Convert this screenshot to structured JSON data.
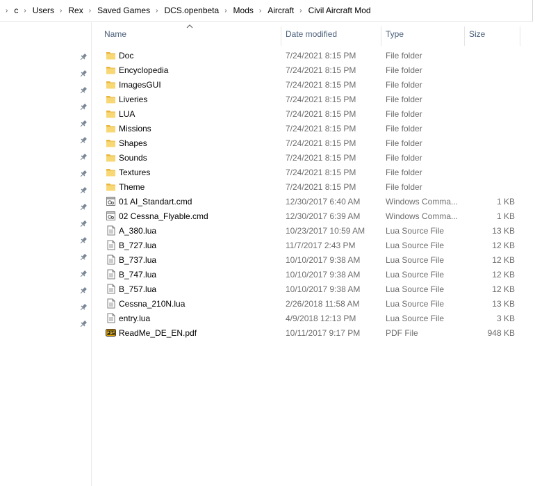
{
  "breadcrumb": [
    "c",
    "Users",
    "Rex",
    "Saved Games",
    "DCS.openbeta",
    "Mods",
    "Aircraft",
    "Civil Aircraft Mod"
  ],
  "columns": {
    "name": "Name",
    "date": "Date modified",
    "type": "Type",
    "size": "Size"
  },
  "sort": {
    "column": "Name",
    "direction": "ascending"
  },
  "pinned_count": 17,
  "files": [
    {
      "name": "Doc",
      "date": "7/24/2021 8:15 PM",
      "type": "File folder",
      "size": "",
      "icon": "folder-icon"
    },
    {
      "name": "Encyclopedia",
      "date": "7/24/2021 8:15 PM",
      "type": "File folder",
      "size": "",
      "icon": "folder-icon"
    },
    {
      "name": "ImagesGUI",
      "date": "7/24/2021 8:15 PM",
      "type": "File folder",
      "size": "",
      "icon": "folder-icon"
    },
    {
      "name": "Liveries",
      "date": "7/24/2021 8:15 PM",
      "type": "File folder",
      "size": "",
      "icon": "folder-icon"
    },
    {
      "name": "LUA",
      "date": "7/24/2021 8:15 PM",
      "type": "File folder",
      "size": "",
      "icon": "folder-icon"
    },
    {
      "name": "Missions",
      "date": "7/24/2021 8:15 PM",
      "type": "File folder",
      "size": "",
      "icon": "folder-icon"
    },
    {
      "name": "Shapes",
      "date": "7/24/2021 8:15 PM",
      "type": "File folder",
      "size": "",
      "icon": "folder-icon"
    },
    {
      "name": "Sounds",
      "date": "7/24/2021 8:15 PM",
      "type": "File folder",
      "size": "",
      "icon": "folder-icon"
    },
    {
      "name": "Textures",
      "date": "7/24/2021 8:15 PM",
      "type": "File folder",
      "size": "",
      "icon": "folder-icon"
    },
    {
      "name": "Theme",
      "date": "7/24/2021 8:15 PM",
      "type": "File folder",
      "size": "",
      "icon": "folder-icon"
    },
    {
      "name": "01 AI_Standart.cmd",
      "date": "12/30/2017 6:40 AM",
      "type": "Windows Comma...",
      "size": "1 KB",
      "icon": "cmd-file-icon"
    },
    {
      "name": "02 Cessna_Flyable.cmd",
      "date": "12/30/2017 6:39 AM",
      "type": "Windows Comma...",
      "size": "1 KB",
      "icon": "cmd-file-icon"
    },
    {
      "name": "A_380.lua",
      "date": "10/23/2017 10:59 AM",
      "type": "Lua Source File",
      "size": "13 KB",
      "icon": "text-file-icon"
    },
    {
      "name": "B_727.lua",
      "date": "11/7/2017 2:43 PM",
      "type": "Lua Source File",
      "size": "12 KB",
      "icon": "text-file-icon"
    },
    {
      "name": "B_737.lua",
      "date": "10/10/2017 9:38 AM",
      "type": "Lua Source File",
      "size": "12 KB",
      "icon": "text-file-icon"
    },
    {
      "name": "B_747.lua",
      "date": "10/10/2017 9:38 AM",
      "type": "Lua Source File",
      "size": "12 KB",
      "icon": "text-file-icon"
    },
    {
      "name": "B_757.lua",
      "date": "10/10/2017 9:38 AM",
      "type": "Lua Source File",
      "size": "12 KB",
      "icon": "text-file-icon"
    },
    {
      "name": "Cessna_210N.lua",
      "date": "2/26/2018 11:58 AM",
      "type": "Lua Source File",
      "size": "13 KB",
      "icon": "text-file-icon"
    },
    {
      "name": "entry.lua",
      "date": "4/9/2018 12:13 PM",
      "type": "Lua Source File",
      "size": "3 KB",
      "icon": "text-file-icon"
    },
    {
      "name": "ReadMe_DE_EN.pdf",
      "date": "10/11/2017 9:17 PM",
      "type": "PDF File",
      "size": "948 KB",
      "icon": "pdf-file-icon"
    }
  ],
  "colors": {
    "folder": "#f8d775",
    "folder_dark": "#e8b740",
    "header_text": "#4c607a",
    "meta_text": "#6d6d6d"
  }
}
